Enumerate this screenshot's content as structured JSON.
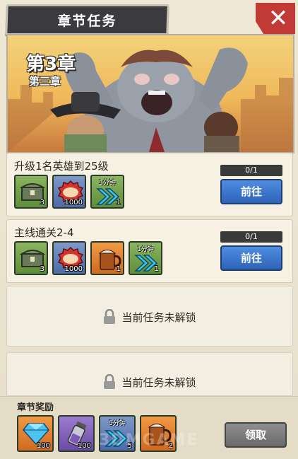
{
  "header": {
    "title": "章节任务",
    "close_label": "✕"
  },
  "banner": {
    "chapter_big": "第3章",
    "chapter_small": "第三章"
  },
  "tasks": [
    {
      "title": "升级1名英雄到25级",
      "progress": "0/1",
      "button": "前往",
      "rewards": [
        {
          "icon": "chest-icon",
          "color": "green",
          "qty": "3"
        },
        {
          "icon": "bottle-cap-icon",
          "color": "blue",
          "qty": "1000"
        },
        {
          "icon": "speedup-icon",
          "color": "green",
          "qty": "1",
          "tag": "1分钟"
        }
      ]
    },
    {
      "title": "主线通关2-4",
      "progress": "0/1",
      "button": "前往",
      "rewards": [
        {
          "icon": "chest-icon",
          "color": "green",
          "qty": "3"
        },
        {
          "icon": "bottle-cap-icon",
          "color": "blue",
          "qty": "1000"
        },
        {
          "icon": "beer-icon",
          "color": "orange",
          "qty": "1"
        },
        {
          "icon": "speedup-icon",
          "color": "green",
          "qty": "1",
          "tag": "1分钟"
        }
      ]
    }
  ],
  "locked_text": "当前任务未解锁",
  "footer": {
    "title": "章节奖励",
    "claim": "领取",
    "rewards": [
      {
        "icon": "diamond-icon",
        "color": "orange",
        "qty": "100"
      },
      {
        "icon": "vial-icon",
        "color": "purple",
        "qty": "100"
      },
      {
        "icon": "speedup-icon",
        "color": "blue",
        "qty": "5",
        "tag": "5分钟"
      },
      {
        "icon": "beer-icon",
        "color": "orange",
        "qty": "2"
      }
    ]
  },
  "watermark": "3DMGAME"
}
